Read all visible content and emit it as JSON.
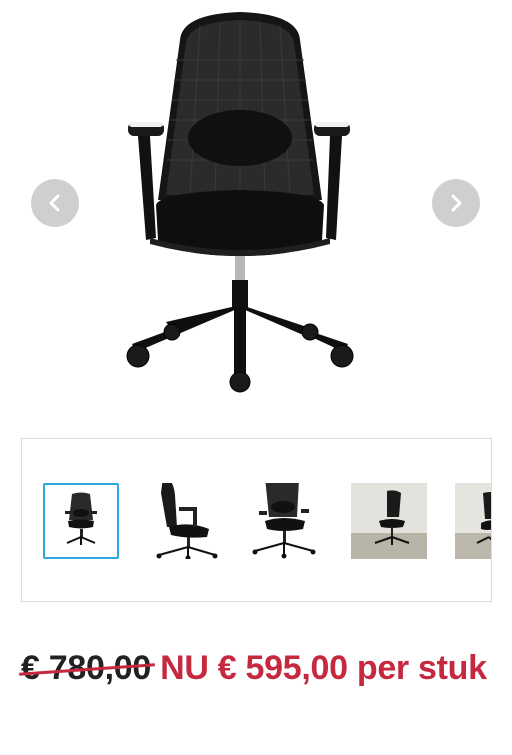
{
  "gallery": {
    "prev_icon": "chevron-left-icon",
    "next_icon": "chevron-right-icon",
    "main_image": "office-chair-front-view",
    "thumbnails": [
      {
        "name": "chair-front",
        "active": true
      },
      {
        "name": "chair-side",
        "active": false
      },
      {
        "name": "chair-back-three-quarter",
        "active": false
      },
      {
        "name": "chair-in-room",
        "active": false
      },
      {
        "name": "chair-in-room-partial",
        "active": false
      }
    ]
  },
  "pricing": {
    "old_price": "€ 780,00",
    "new_price": "NU € 595,00 per stuk"
  },
  "colors": {
    "accent_red": "#c5283f",
    "thumb_active_border": "#2ea7df",
    "nav_button_bg": "#cfcfcf"
  }
}
